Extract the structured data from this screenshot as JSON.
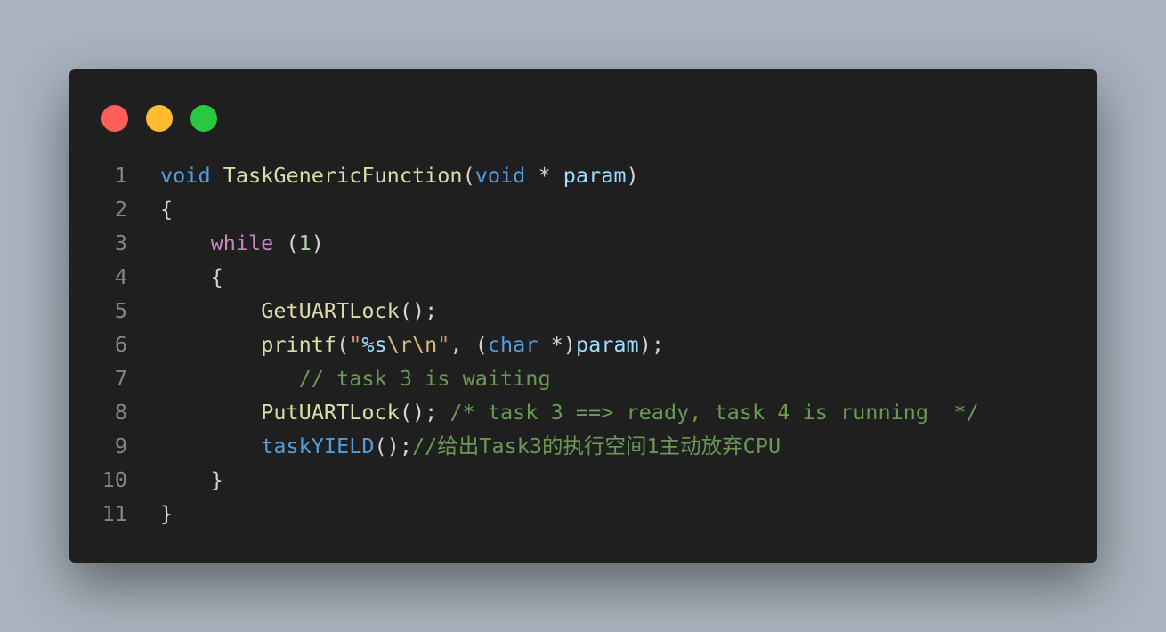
{
  "window": {
    "traffic_lights": [
      {
        "name": "close",
        "color": "#ff5f57"
      },
      {
        "name": "minimize",
        "color": "#febc2e"
      },
      {
        "name": "maximize",
        "color": "#28c840"
      }
    ]
  },
  "code": {
    "lines": [
      {
        "n": "1",
        "tokens": [
          {
            "t": "void",
            "c": "kw"
          },
          {
            "t": " ",
            "c": ""
          },
          {
            "t": "TaskGenericFunction",
            "c": "fn"
          },
          {
            "t": "(",
            "c": ""
          },
          {
            "t": "void",
            "c": "kw"
          },
          {
            "t": " * ",
            "c": ""
          },
          {
            "t": "param",
            "c": "param"
          },
          {
            "t": ")",
            "c": ""
          }
        ]
      },
      {
        "n": "2",
        "tokens": [
          {
            "t": "{",
            "c": ""
          }
        ]
      },
      {
        "n": "3",
        "tokens": [
          {
            "t": "    ",
            "c": ""
          },
          {
            "t": "while",
            "c": "ctl"
          },
          {
            "t": " (",
            "c": ""
          },
          {
            "t": "1",
            "c": "num"
          },
          {
            "t": ")",
            "c": ""
          }
        ]
      },
      {
        "n": "4",
        "tokens": [
          {
            "t": "    {",
            "c": ""
          }
        ]
      },
      {
        "n": "5",
        "tokens": [
          {
            "t": "        ",
            "c": ""
          },
          {
            "t": "GetUARTLock",
            "c": "fn"
          },
          {
            "t": "();",
            "c": ""
          }
        ]
      },
      {
        "n": "6",
        "tokens": [
          {
            "t": "        ",
            "c": ""
          },
          {
            "t": "printf",
            "c": "fn"
          },
          {
            "t": "(",
            "c": ""
          },
          {
            "t": "\"",
            "c": "str"
          },
          {
            "t": "%s",
            "c": "param"
          },
          {
            "t": "\\r\\n",
            "c": "esc"
          },
          {
            "t": "\"",
            "c": "str"
          },
          {
            "t": ", (",
            "c": ""
          },
          {
            "t": "char",
            "c": "kw"
          },
          {
            "t": " *)",
            "c": ""
          },
          {
            "t": "param",
            "c": "param"
          },
          {
            "t": ");",
            "c": ""
          }
        ]
      },
      {
        "n": "7",
        "tokens": [
          {
            "t": "           ",
            "c": ""
          },
          {
            "t": "// task 3 is waiting",
            "c": "cmt"
          }
        ]
      },
      {
        "n": "8",
        "tokens": [
          {
            "t": "        ",
            "c": ""
          },
          {
            "t": "PutUARTLock",
            "c": "fn"
          },
          {
            "t": "(); ",
            "c": ""
          },
          {
            "t": "/* task 3 ==> ready, task 4 is running  */",
            "c": "cmt"
          }
        ]
      },
      {
        "n": "9",
        "tokens": [
          {
            "t": "        ",
            "c": ""
          },
          {
            "t": "taskYIELD",
            "c": "macro"
          },
          {
            "t": "();",
            "c": ""
          },
          {
            "t": "//给出Task3的执行空间1主动放弃CPU",
            "c": "cmt"
          }
        ]
      },
      {
        "n": "10",
        "tokens": [
          {
            "t": "    }",
            "c": ""
          }
        ]
      },
      {
        "n": "11",
        "tokens": [
          {
            "t": "}",
            "c": ""
          }
        ]
      }
    ]
  }
}
